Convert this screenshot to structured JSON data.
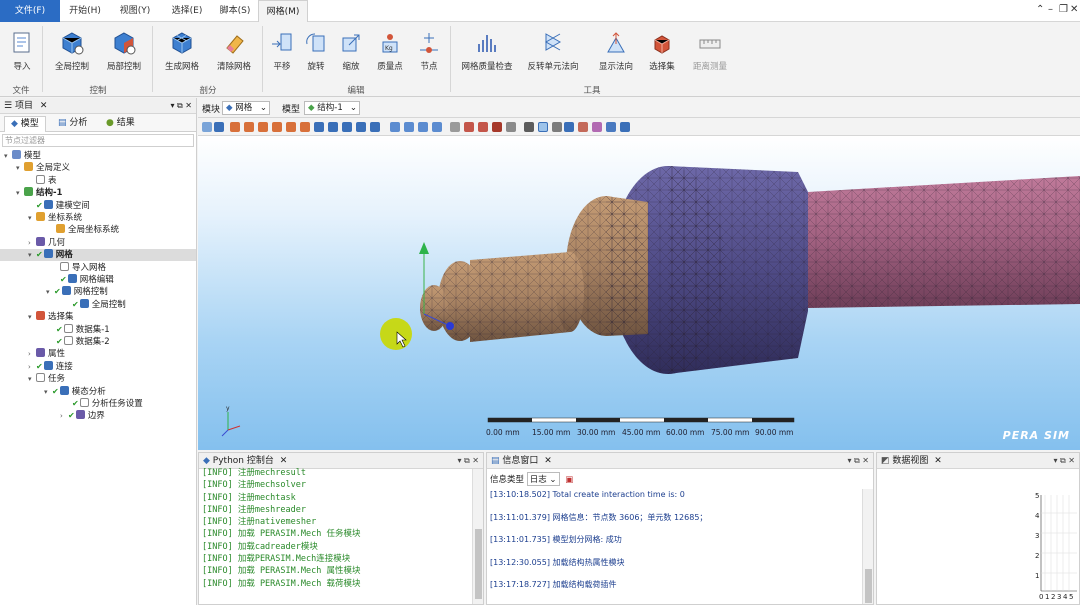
{
  "menu": {
    "file": "文件(F)",
    "tabs": [
      "开始(H)",
      "视图(Y)",
      "选择(E)",
      "脚本(S)",
      "网格(M)"
    ]
  },
  "ribbon": {
    "buttons": [
      "导入",
      "全局控制",
      "局部控制",
      "生成网格",
      "清除网格",
      "平移",
      "旋转",
      "缩放",
      "质量点",
      "节点",
      "网格质量检查",
      "反转单元法向",
      "显示法向",
      "选择集",
      "距离测量"
    ],
    "groups": [
      "文件",
      "控制",
      "剖分",
      "编辑",
      "工具"
    ]
  },
  "left_panel": {
    "title": "项目",
    "tabs": [
      "模型",
      "分析",
      "结果"
    ],
    "filter_placeholder": "节点过滤器",
    "tree": [
      "模型",
      "全局定义",
      "表",
      "结构-1",
      "建模空间",
      "坐标系统",
      "全局坐标系统",
      "几何",
      "网格",
      "导入网格",
      "网格编辑",
      "网格控制",
      "全局控制",
      "选择集",
      "数据集-1",
      "数据集-2",
      "属性",
      "连接",
      "任务",
      "模态分析",
      "分析任务设置",
      "边界"
    ]
  },
  "module_bar": {
    "module_label": "模块",
    "module_value": "网格",
    "model_label": "模型",
    "model_value": "结构-1"
  },
  "viewport": {
    "scale_labels": [
      "0.00 mm",
      "15.00 mm",
      "30.00 mm",
      "45.00 mm",
      "60.00 mm",
      "75.00 mm",
      "90.00 mm"
    ],
    "brand": "PERA SIM",
    "colors": {
      "shaft_tan": "#a88363",
      "shaft_purple": "#4f4b86",
      "shaft_pink": "#a0607f",
      "cursor": "#c9d800"
    }
  },
  "python_panel": {
    "title": "Python 控制台",
    "lines": [
      "[INFO] 注册mechresult",
      "[INFO] 注册mechsolver",
      "[INFO] 注册mechtask",
      "[INFO] 注册meshreader",
      "[INFO] 注册nativemesher",
      "[INFO] 加载 PERASIM.Mech 任务模块",
      "[INFO] 加载cadreader模块",
      "[INFO] 加载PERASIM.Mech连接模块",
      "[INFO] 加载 PERASIM.Mech 属性模块",
      "[INFO] 加载 PERASIM.Mech 载荷模块"
    ]
  },
  "info_panel": {
    "title": "信息窗口",
    "type_label": "信息类型",
    "type_value": "日志",
    "lines": [
      "[13:10:18.502] Total create interaction time is: 0",
      "[13:11:01.379] 网格信息：节点数 3606；单元数 12685；",
      "[13:11:01.735] 模型划分网格: 成功",
      "[13:12:30.055] 加载结构热属性模块",
      "[13:17:18.727] 加载结构载荷插件"
    ]
  },
  "data_panel": {
    "title": "数据视图",
    "y_ticks": [
      "5",
      "4",
      "3",
      "2",
      "1"
    ],
    "x_ticks": [
      "0",
      "1",
      "2",
      "3",
      "4",
      "5"
    ]
  }
}
